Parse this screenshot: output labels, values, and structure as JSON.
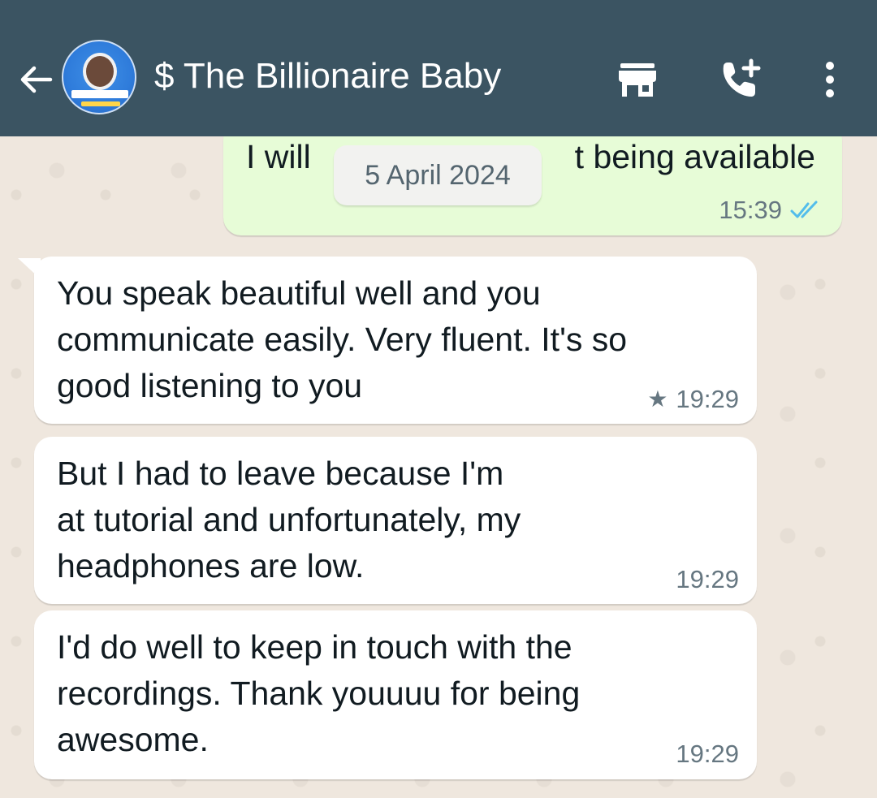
{
  "header": {
    "title": "$ The Billionaire Baby",
    "icons": [
      "back-arrow-icon",
      "storefront-icon",
      "add-call-icon",
      "more-vert-icon"
    ]
  },
  "colors": {
    "header_bg": "#3b5462",
    "outgoing_bubble": "#e7fcd7",
    "incoming_bubble": "#ffffff",
    "read_ticks": "#53bdeb"
  },
  "date_chip": "5 April 2024",
  "messages": [
    {
      "direction": "outgoing",
      "text": "I will work on that being available",
      "visible_text_left": "I will ",
      "visible_text_right": "t being available",
      "time": "15:39",
      "status": "read"
    },
    {
      "direction": "incoming",
      "text": "You speak beautiful well and you\ncommunicate easily. Very fluent. It's so\ngood listening to you",
      "time": "19:29",
      "starred": true
    },
    {
      "direction": "incoming",
      "text": "But I had to leave because I'm\nat tutorial and unfortunately, my\nheadphones are low.",
      "time": "19:29",
      "starred": false
    },
    {
      "direction": "incoming",
      "text": "I'd do well to keep in touch with the\nrecordings. Thank youuuu for being\nawesome.",
      "time": "19:29",
      "starred": false
    }
  ]
}
